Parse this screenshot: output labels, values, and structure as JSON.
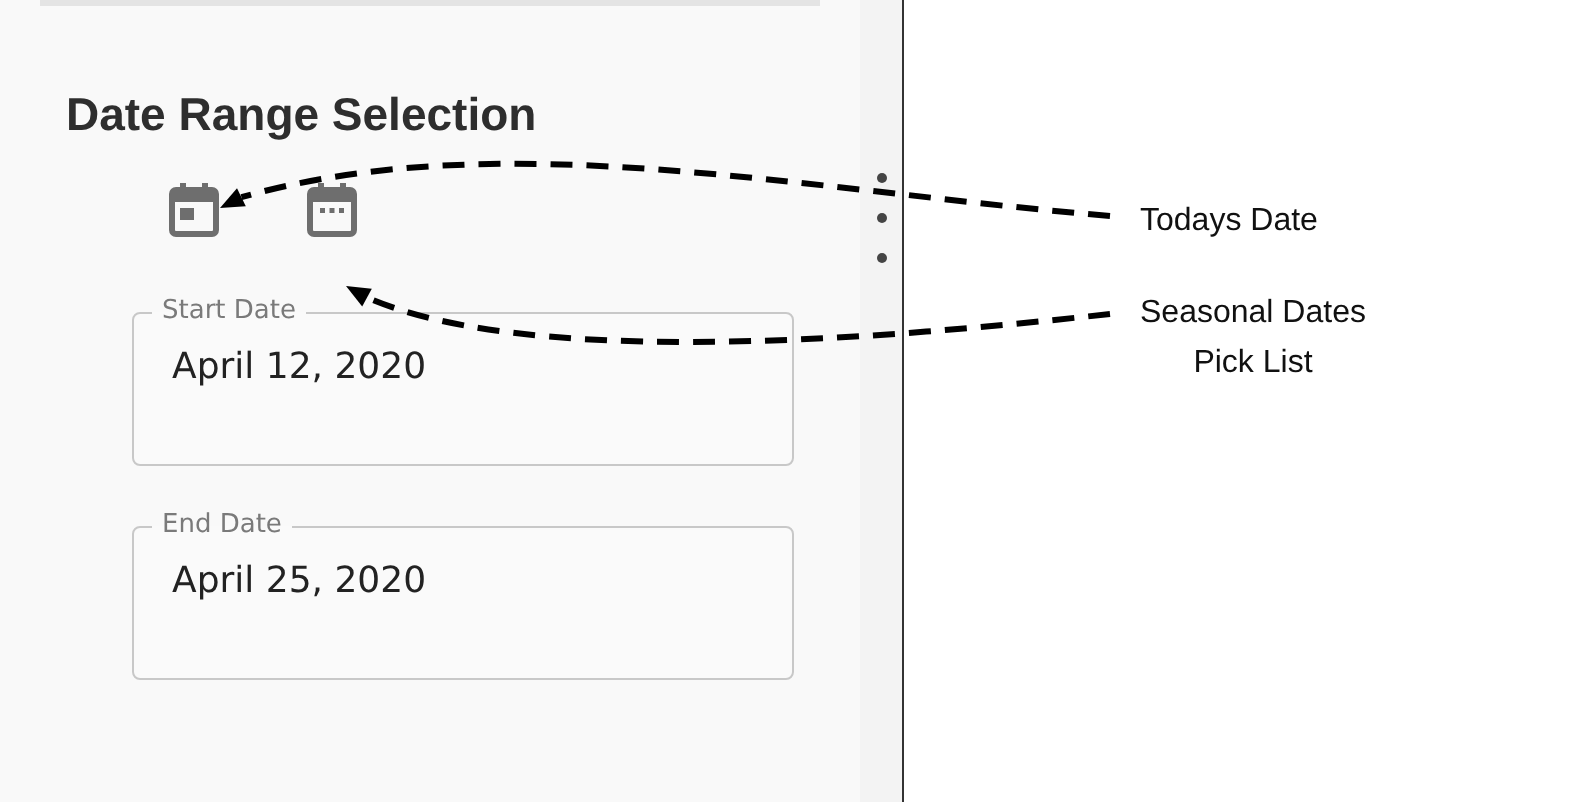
{
  "panel": {
    "title": "Date Range Selection",
    "fields": [
      {
        "label": "Start Date",
        "value": "April 12, 2020"
      },
      {
        "label": "End Date",
        "value": "April 25, 2020"
      }
    ]
  },
  "annotations": [
    {
      "lines": [
        "Todays Date"
      ]
    },
    {
      "lines": [
        "Seasonal Dates",
        "Pick List"
      ]
    }
  ]
}
